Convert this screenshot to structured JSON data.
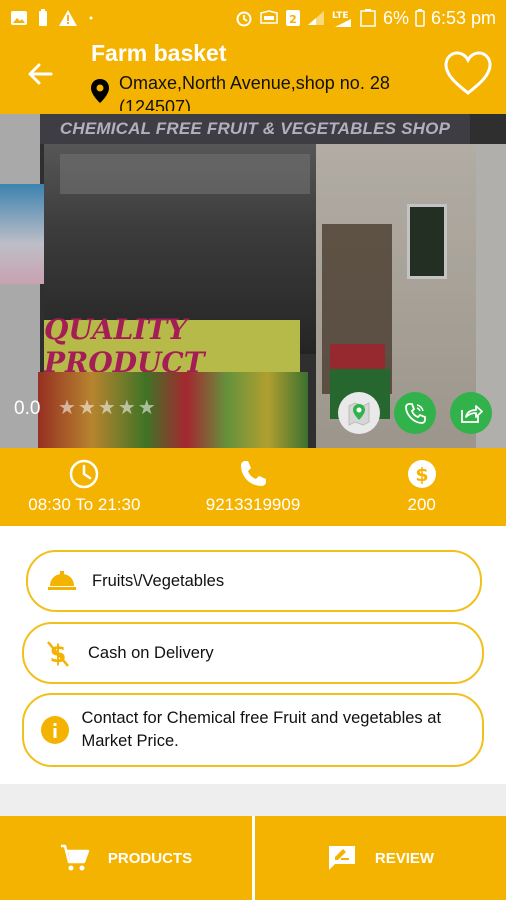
{
  "status_bar": {
    "network": "LTE",
    "battery": "6%",
    "time": "6:53 pm"
  },
  "header": {
    "title": "Farm basket",
    "address": "Omaxe,North Avenue,shop no. 28 (124507)"
  },
  "photo": {
    "shop_sign": "CHEMICAL FREE FRUIT & VEGETABLES SHOP",
    "banner_text": "QUALITY PRODUCT"
  },
  "rating": {
    "value": "0.0",
    "stars": 0,
    "max_stars": 5
  },
  "info": {
    "timing": "08:30 To 21:30",
    "phone": "9213319909",
    "price": "200"
  },
  "cards": {
    "category": "Fruits\\/Vegetables",
    "payment": "Cash on Delivery",
    "description": "Contact for Chemical free Fruit and vegetables at Market Price."
  },
  "bottom": {
    "products_label": "PRODUCTS",
    "review_label": "REVIEW"
  },
  "colors": {
    "accent": "#f5b301",
    "card_border": "#f2c01d",
    "action_green": "#31b24a"
  }
}
